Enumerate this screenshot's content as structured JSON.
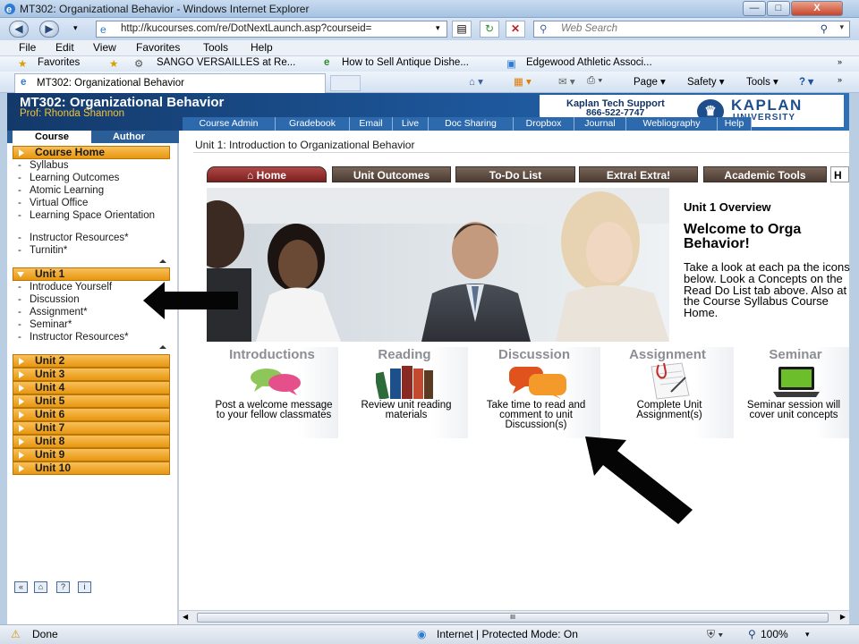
{
  "window": {
    "title": "MT302: Organizational Behavior - Windows Internet Explorer",
    "minimize": "—",
    "maximize": "□",
    "close": "X"
  },
  "address": {
    "url": "http://kucourses.com/re/DotNextLaunch.asp?courseid=",
    "search_placeholder": "Web Search"
  },
  "menu": [
    "File",
    "Edit",
    "View",
    "Favorites",
    "Tools",
    "Help"
  ],
  "favorites": {
    "label": "Favorites",
    "items": [
      "SANGO VERSAILLES at Re...",
      "How to Sell Antique Dishe...",
      "Edgewood Athletic Associ..."
    ]
  },
  "tab": {
    "title": "MT302: Organizational Behavior"
  },
  "commands": {
    "page": "Page ▾",
    "safety": "Safety ▾",
    "tools": "Tools ▾",
    "help": "? ▾"
  },
  "course": {
    "title": "MT302: Organizational Behavior",
    "prof": "Prof:  Rhonda Shannon"
  },
  "support": {
    "line1": "Kaplan Tech Support",
    "line2": "866-522-7747"
  },
  "logo": {
    "name": "KAPLAN",
    "sub": "UNIVERSITY"
  },
  "topnav": [
    "Course Admin",
    "Gradebook",
    "Email",
    "Live",
    "Doc Sharing",
    "Dropbox",
    "Journal",
    "Webliography",
    "Help"
  ],
  "sidebar": {
    "tab_course": "Course",
    "tab_author": "Author",
    "course_home": "Course Home",
    "home_items": [
      "Syllabus",
      "Learning Outcomes",
      "Atomic Learning",
      "Virtual Office",
      "Learning Space Orientation",
      "Instructor Resources*",
      "Turnitin*"
    ],
    "unit1": "Unit 1",
    "unit1_items": [
      "Introduce Yourself",
      "Discussion",
      "Assignment*",
      "Seminar*",
      "Instructor Resources*"
    ],
    "units": [
      "Unit 2",
      "Unit 3",
      "Unit 4",
      "Unit 5",
      "Unit 6",
      "Unit 7",
      "Unit 8",
      "Unit 9",
      "Unit 10"
    ]
  },
  "main": {
    "breadcrumb": "Unit 1: Introduction to Organizational Behavior",
    "tabs": [
      "Home",
      "Unit Outcomes",
      "To-Do List",
      "Extra! Extra!",
      "Academic Tools",
      "H"
    ],
    "overview_title": "Unit 1 Overview",
    "welcome": "Welcome to Orga Behavior!",
    "paragraph": "Take a look at each pa the icons below. Look a Concepts on the Read Do List tab above. Also at the Course Syllabus Course Home.",
    "icons": [
      {
        "title": "Introductions",
        "desc": "Post a welcome message to your fellow classmates",
        "icon": "speech-bubbles-icon"
      },
      {
        "title": "Reading",
        "desc": "Review unit reading materials",
        "icon": "books-icon"
      },
      {
        "title": "Discussion",
        "desc": "Take time to read and comment to unit Discussion(s)",
        "icon": "discussion-bubbles-icon"
      },
      {
        "title": "Assignment",
        "desc": "Complete Unit Assignment(s)",
        "icon": "paper-clip-document-icon"
      },
      {
        "title": "Seminar",
        "desc": "Seminar session will cover unit concepts",
        "icon": "laptop-icon"
      }
    ]
  },
  "status": {
    "left": "Done",
    "zone": "Internet | Protected Mode: On",
    "zoom": "100%"
  },
  "colors": {
    "banner": "#1d5699",
    "accent_orange": "#f0a530",
    "home_tab": "#a23b3b",
    "nav_tab": "#5d4b40"
  }
}
